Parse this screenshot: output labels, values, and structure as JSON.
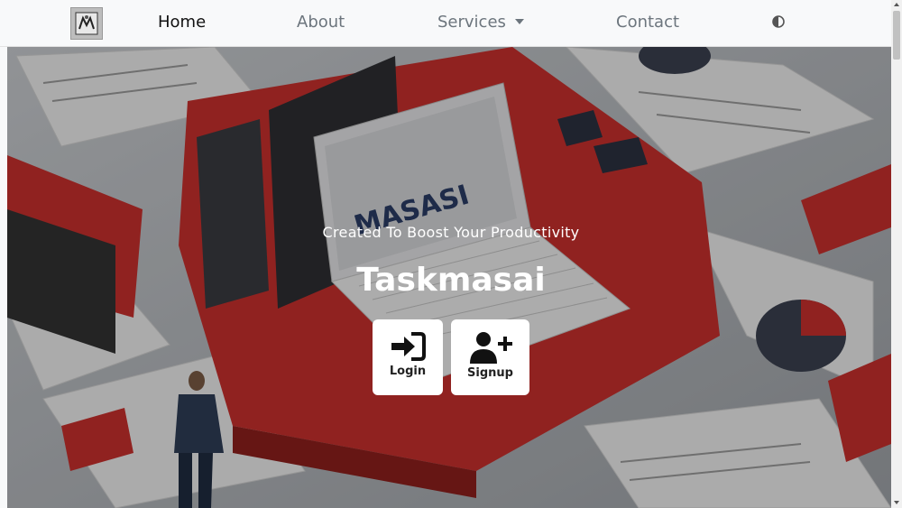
{
  "nav": {
    "logo_icon": "masasi-logo-icon",
    "items": [
      {
        "label": "Home",
        "active": true
      },
      {
        "label": "About"
      },
      {
        "label": "Services",
        "has_dropdown": true
      },
      {
        "label": "Contact"
      }
    ],
    "theme_toggle_icon": "contrast-icon"
  },
  "hero": {
    "background": "isometric illustration of laptop with MASASI screen, computers, documents and a businessman on red and grey platforms",
    "laptop_screen_text": "MASASI",
    "tagline": "Created To Boost Your Productivity",
    "title": "Taskmasai",
    "buttons": [
      {
        "label": "Login",
        "icon": "sign-in-icon"
      },
      {
        "label": "Signup",
        "icon": "user-plus-icon"
      }
    ]
  },
  "colors": {
    "navbar_bg": "#f8f9fa",
    "accent_red": "#d1322f",
    "text_muted": "#6c757d"
  }
}
